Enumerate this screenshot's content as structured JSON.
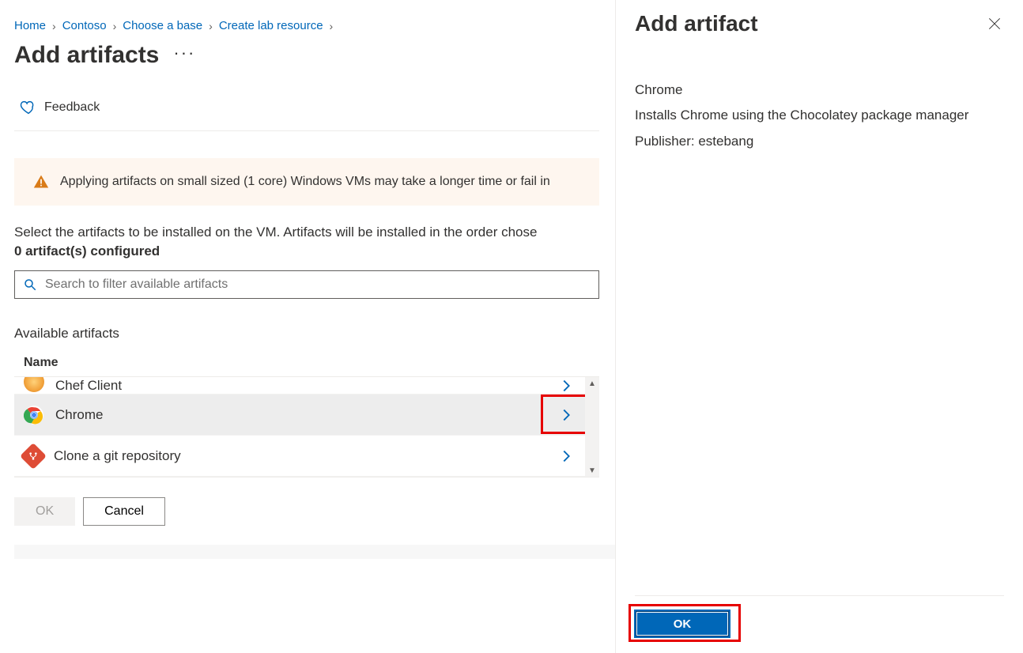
{
  "breadcrumb": {
    "home": "Home",
    "contoso": "Contoso",
    "choose_base": "Choose a base",
    "create_lab": "Create lab resource"
  },
  "page_title": "Add artifacts",
  "feedback_label": "Feedback",
  "warning_text": "Applying artifacts on small sized (1 core) Windows VMs may take a longer time or fail in",
  "intro_text": "Select the artifacts to be installed on the VM. Artifacts will be installed in the order chose",
  "configured_text": "0 artifact(s) configured",
  "search_placeholder": "Search to filter available artifacts",
  "available_section": "Available artifacts",
  "column_name": "Name",
  "artifacts": {
    "chef": "Chef Client",
    "chrome": "Chrome",
    "git": "Clone a git repository"
  },
  "footer": {
    "ok": "OK",
    "cancel": "Cancel"
  },
  "panel": {
    "title": "Add artifact",
    "name": "Chrome",
    "desc": "Installs Chrome using the Chocolatey package manager",
    "publisher": "Publisher: estebang",
    "ok": "OK"
  }
}
